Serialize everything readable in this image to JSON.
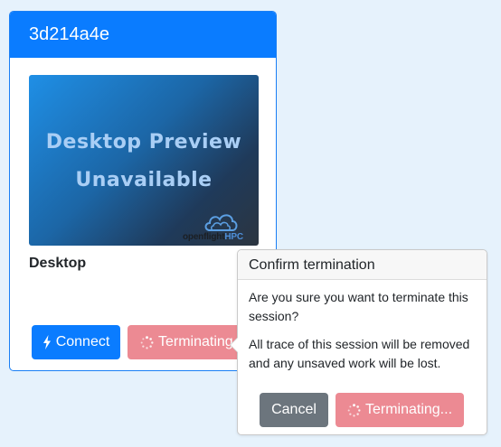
{
  "session": {
    "id": "3d214a4e",
    "name": "Desktop",
    "preview": {
      "line1": "Desktop Preview",
      "line2": "Unavailable",
      "logo_brand": "openflight",
      "logo_suffix": "HPC"
    },
    "connect_label": "Connect",
    "connect_icon": "lightning-bolt-icon",
    "terminating_label": "Terminating...",
    "terminating_icon": "spinner-icon"
  },
  "popover": {
    "title": "Confirm termination",
    "message1": "Are you sure you want to terminate this session?",
    "message2": "All trace of this session will be removed and any unsaved work will be lost.",
    "cancel_label": "Cancel",
    "confirm_label": "Terminating..."
  },
  "colors": {
    "primary": "#0a7cff",
    "danger_disabled": "#ec8a93",
    "secondary": "#6c757d",
    "background": "#e6f2fc"
  }
}
